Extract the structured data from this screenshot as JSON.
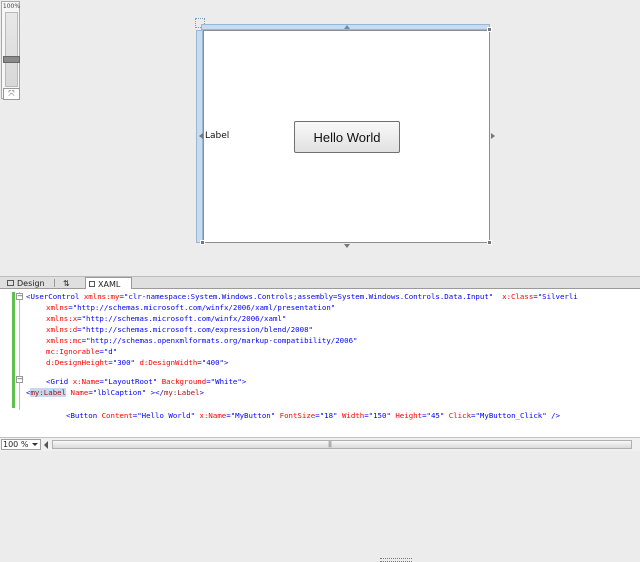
{
  "zoom_panel": {
    "value": "100%"
  },
  "design": {
    "label_text": "Label",
    "button_text": "Hello World"
  },
  "tabs": {
    "design": "Design",
    "swap": "⇅",
    "xaml": "XAML"
  },
  "code": {
    "l1_open": "<UserControl ",
    "l1_attr": "xmlns:my",
    "l1_eq": "=",
    "l1_val": "\"clr-namespace:System.Windows.Controls;assembly=System.Windows.Controls.Data.Input\"",
    "l1_attr2": "  x:Class",
    "l1_eq2": "=",
    "l1_val2": "\"Silverli",
    "l2_attr": "xmlns",
    "l2_val": "\"http://schemas.microsoft.com/winfx/2006/xaml/presentation\"",
    "l3_attr": "xmlns:x",
    "l3_val": "\"http://schemas.microsoft.com/winfx/2006/xaml\"",
    "l4_attr": "xmlns:d",
    "l4_val": "\"http://schemas.microsoft.com/expression/blend/2008\"",
    "l5_attr": "xmlns:mc",
    "l5_val": "\"http://schemas.openxmlformats.org/markup-compatibility/2006\"",
    "l6_attr": "mc:Ignorable",
    "l6_val": "\"d\"",
    "l7_attr1": "d:DesignHeight",
    "l7_val1": "\"300\"",
    "l7_attr2": " d:DesignWidth",
    "l7_val2": "\"400\"",
    "l7_close": ">",
    "l8_open": "<Grid ",
    "l8_attr1": "x:Name",
    "l8_val1": "\"LayoutRoot\"",
    "l8_attr2": " Background",
    "l8_val2": "\"White\"",
    "l8_close": ">",
    "l9_lt": "<",
    "l9_sel": "my:Label",
    "l9_attr": " Name",
    "l9_val": "\"lblCaption\"",
    "l9_close": " ></",
    "l9_tag": "my:Label",
    "l9_gt": ">",
    "l11_open": "<Button ",
    "l11_a1": "Content",
    "l11_v1": "\"Hello World\"",
    "l11_a2": " x:Name",
    "l11_v2": "\"MyButton\"",
    "l11_a3": " FontSize",
    "l11_v3": "\"18\"",
    "l11_a4": " Width",
    "l11_v4": "\"150\"",
    "l11_a5": " Height",
    "l11_v5": "\"45\"",
    "l11_a6": " Click",
    "l11_v6": "\"MyButton_Click\"",
    "l11_close": " />",
    "eq": "="
  },
  "status": {
    "zoom": "100 %"
  }
}
